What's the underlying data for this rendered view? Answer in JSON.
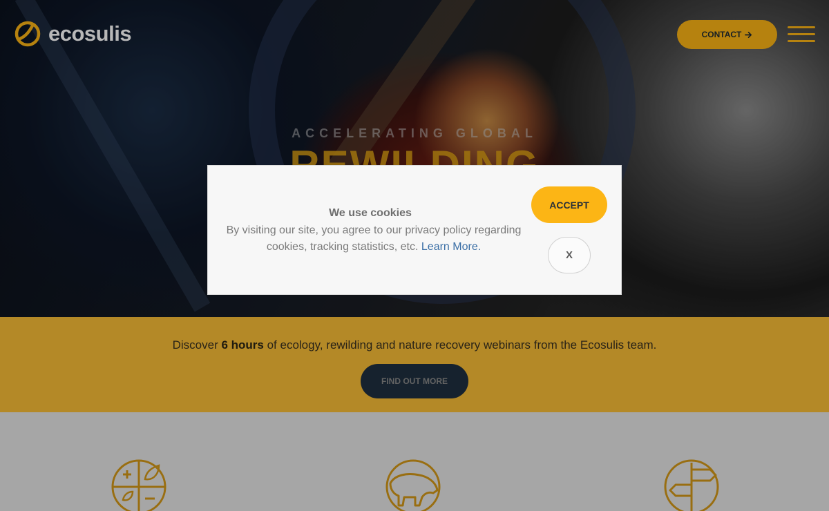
{
  "brand": {
    "name": "ecosulis",
    "accent": "#fcb515",
    "logo_icon": "ecosulis-logo-icon"
  },
  "nav": {
    "contact_label": "CONTACT",
    "contact_icon": "arrow-right-icon",
    "menu_icon": "hamburger-menu-icon"
  },
  "hero": {
    "tagline": "ACCELERATING GLOBAL",
    "headline": "REWILDING"
  },
  "banner": {
    "text_before": "Discover ",
    "text_bold": "6 hours",
    "text_after": " of ecology, rewilding and nature recovery webinars from the Ecosulis team.",
    "button_label": "FIND OUT MORE"
  },
  "cookie": {
    "title": "We use cookies",
    "body": "By visiting our site, you agree to our privacy policy regarding cookies, tracking statistics, etc.",
    "link_label": "Learn More.",
    "accept_label": "ACCEPT",
    "close_label": "X"
  },
  "features": [
    {
      "icon": "ecology-balance-icon"
    },
    {
      "icon": "bison-icon"
    },
    {
      "icon": "signpost-icon"
    }
  ]
}
